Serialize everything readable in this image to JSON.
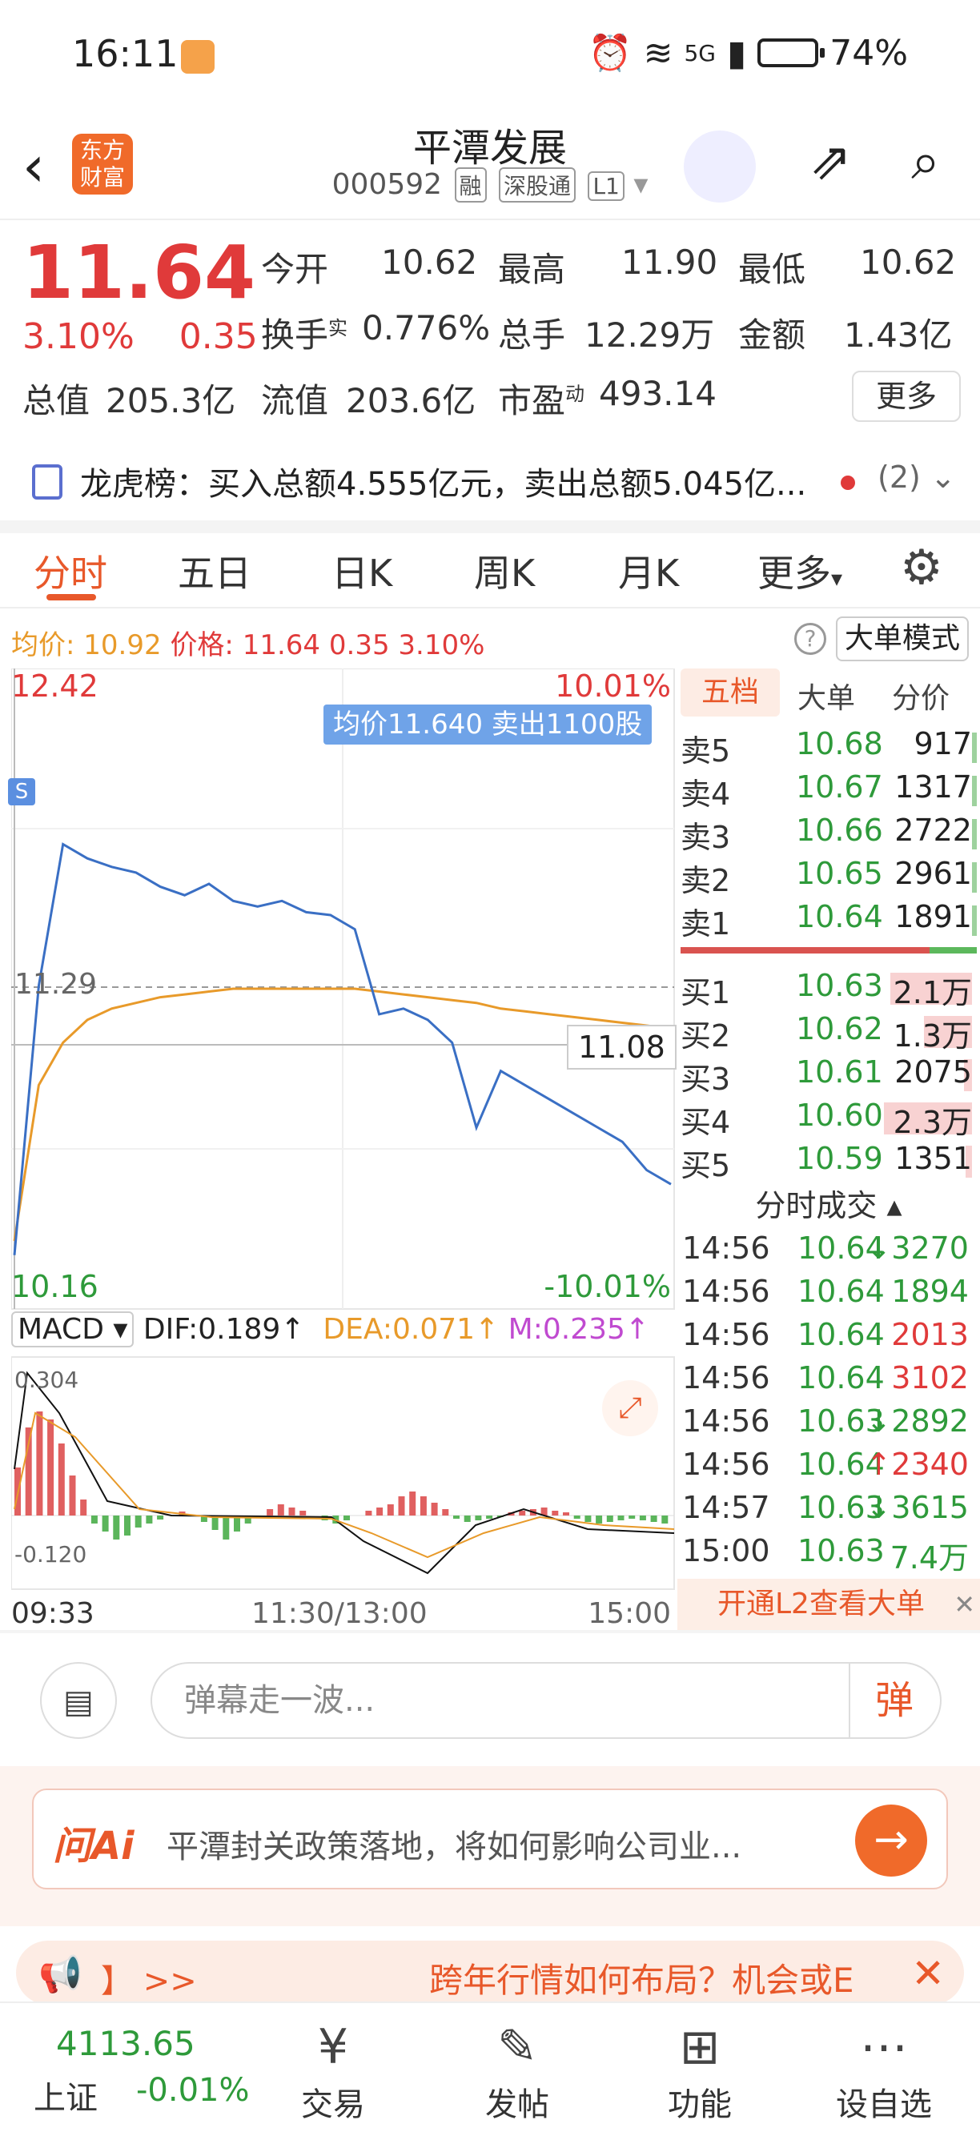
{
  "status_bar": {
    "time": "16:11",
    "network": "5G",
    "battery": "74%"
  },
  "header": {
    "logo_text": "东方财富",
    "title": "平潭发展",
    "code": "000592",
    "tags": [
      "融",
      "深股通",
      "L1"
    ]
  },
  "quote": {
    "price": "11.64",
    "change_pct": "3.10%",
    "change": "0.35",
    "open_label": "今开",
    "open": "10.62",
    "high_label": "最高",
    "high": "11.90",
    "low_label": "最低",
    "low": "10.62",
    "turnover_label": "换手",
    "turnover_sup": "实",
    "turnover": "0.776%",
    "volume_label": "总手",
    "volume": "12.29万",
    "amount_label": "金额",
    "amount": "1.43亿",
    "mktcap_label": "总值",
    "mktcap": "205.3亿",
    "float_label": "流值",
    "float_cap": "203.6亿",
    "pe_label": "市盈",
    "pe_sup": "动",
    "pe": "493.14",
    "more_label": "更多"
  },
  "dragon": {
    "text": "龙虎榜：买入总额4.555亿元，卖出总额5.045亿...",
    "count": "(2)"
  },
  "tabs": {
    "items": [
      "分时",
      "五日",
      "日K",
      "周K",
      "月K",
      "更多"
    ],
    "active": 0
  },
  "price_line": {
    "avg_label": "均价:",
    "avg": "10.92",
    "price_label": "价格:",
    "price": "11.64",
    "chg": "0.35",
    "pct": "3.10%",
    "help": "?",
    "mode_button": "大单模式"
  },
  "chart": {
    "y_top": "12.42",
    "y_bottom": "10.16",
    "pct_top": "10.01%",
    "pct_bottom": "-10.01%",
    "ref_price": "11.29",
    "cross_price": "11.08",
    "tooltip": "均价11.640  卖出1100股",
    "badge": "S",
    "x_labels": [
      "09:33",
      "11:30/13:00",
      "15:00"
    ],
    "macd": {
      "selector": "MACD",
      "dif": "DIF:0.189↑",
      "dea": "DEA:0.071↑",
      "m": "M:0.235↑",
      "top": "0.304",
      "bottom": "-0.120"
    }
  },
  "chart_data": {
    "type": "line",
    "title": "",
    "ylim": [
      10.16,
      12.42
    ],
    "series": [
      {
        "name": "价格",
        "values": [
          10.35,
          11.3,
          11.8,
          11.75,
          11.72,
          11.7,
          11.65,
          11.62,
          11.66,
          11.6,
          11.58,
          11.6,
          11.56,
          11.55,
          11.5,
          11.2,
          11.22,
          11.18,
          11.1,
          10.8,
          11.0,
          10.95,
          10.9,
          10.85,
          10.8,
          10.75,
          10.65,
          10.6
        ]
      },
      {
        "name": "均价",
        "values": [
          10.4,
          10.95,
          11.1,
          11.18,
          11.22,
          11.24,
          11.26,
          11.27,
          11.28,
          11.29,
          11.29,
          11.29,
          11.29,
          11.29,
          11.29,
          11.28,
          11.27,
          11.26,
          11.25,
          11.24,
          11.22,
          11.21,
          11.2,
          11.19,
          11.18,
          11.17,
          11.16,
          11.15
        ]
      }
    ]
  },
  "order_book": {
    "tabs": [
      "五档",
      "大单",
      "分价"
    ],
    "asks": [
      {
        "label": "卖5",
        "price": "10.68",
        "vol": "917"
      },
      {
        "label": "卖4",
        "price": "10.67",
        "vol": "1317"
      },
      {
        "label": "卖3",
        "price": "10.66",
        "vol": "2722"
      },
      {
        "label": "卖2",
        "price": "10.65",
        "vol": "2961"
      },
      {
        "label": "卖1",
        "price": "10.64",
        "vol": "1891"
      }
    ],
    "bids": [
      {
        "label": "买1",
        "price": "10.63",
        "vol": "2.1万"
      },
      {
        "label": "买2",
        "price": "10.62",
        "vol": "1.3万"
      },
      {
        "label": "买3",
        "price": "10.61",
        "vol": "2075"
      },
      {
        "label": "买4",
        "price": "10.60",
        "vol": "2.3万"
      },
      {
        "label": "买5",
        "price": "10.59",
        "vol": "1351"
      }
    ],
    "trades_header": "分时成交",
    "trades": [
      {
        "time": "14:56",
        "price": "10.64",
        "arrow": "↓",
        "vol": "3270",
        "color": "#2e9a3a"
      },
      {
        "time": "14:56",
        "price": "10.64",
        "arrow": "",
        "vol": "1894",
        "color": "#2e9a3a"
      },
      {
        "time": "14:56",
        "price": "10.64",
        "arrow": "",
        "vol": "2013",
        "color": "#e03a3a"
      },
      {
        "time": "14:56",
        "price": "10.64",
        "arrow": "",
        "vol": "3102",
        "color": "#e03a3a"
      },
      {
        "time": "14:56",
        "price": "10.63",
        "arrow": "↓",
        "vol": "2892",
        "color": "#2e9a3a"
      },
      {
        "time": "14:56",
        "price": "10.64",
        "arrow": "↑",
        "vol": "2340",
        "color": "#e03a3a"
      },
      {
        "time": "14:57",
        "price": "10.63",
        "arrow": "↓",
        "vol": "3615",
        "color": "#2e9a3a"
      },
      {
        "time": "15:00",
        "price": "10.63",
        "arrow": "",
        "vol": "7.4万",
        "color": "#2e9a3a"
      }
    ],
    "l2_text": "开通L2查看大单"
  },
  "danmu": {
    "placeholder": "弹幕走一波...",
    "button": "弹"
  },
  "ai": {
    "logo": "问Ai",
    "text": "平潭封关政策落地，将如何影响公司业..."
  },
  "marquee": {
    "arrows": "】 >>",
    "text": "跨年行情如何布局？机会或E"
  },
  "bottom_nav": {
    "index_value": "4113.65",
    "index_name": "上证",
    "index_change": "-0.01%",
    "items": [
      "交易",
      "发帖",
      "功能",
      "设自选"
    ]
  },
  "colors": {
    "up": "#e03a3a",
    "down": "#2e9a3a",
    "accent": "#e8582a",
    "avg_line": "#e89a2a",
    "price_line": "#3a6fc4"
  }
}
